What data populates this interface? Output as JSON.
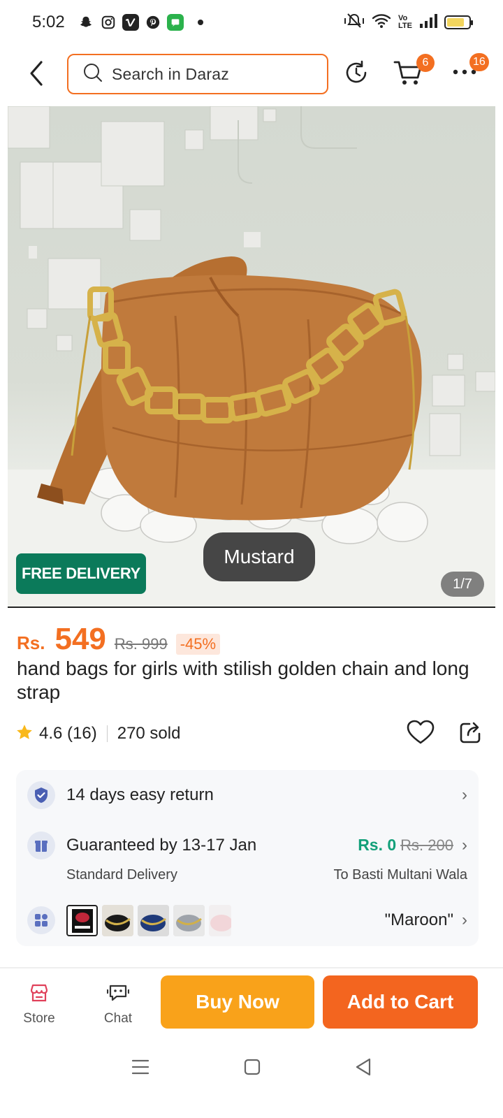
{
  "status_bar": {
    "time": "5:02",
    "app_icons": [
      "snapchat-icon",
      "instagram-icon",
      "vimeo-icon",
      "pinterest-icon",
      "messages-icon"
    ],
    "volte": "Vo LTE"
  },
  "header": {
    "search_placeholder": "Search in Daraz",
    "cart_badge": "6",
    "more_badge": "16"
  },
  "product": {
    "image_badge": "FREE DELIVERY",
    "variant_chip": "Mustard",
    "image_counter": "1/7",
    "currency": "Rs.",
    "price": "549",
    "old_price": "Rs. 999",
    "discount": "-45%",
    "title": "hand bags for girls with stilish golden chain and long strap",
    "rating": "4.6 (16)",
    "sold": "270 sold"
  },
  "info": {
    "return_text": "14 days easy return",
    "delivery_guarantee": "Guaranteed by 13-17 Jan",
    "delivery_type": "Standard Delivery",
    "shipping_price": "Rs. 0",
    "shipping_old_price": "Rs. 200",
    "delivery_location": "To Basti Multani Wala",
    "selected_variant": "\"Maroon\""
  },
  "bottom_bar": {
    "store_label": "Store",
    "chat_label": "Chat",
    "buy_now": "Buy Now",
    "add_to_cart": "Add to Cart"
  },
  "colors": {
    "brand_orange": "#f36f21",
    "buy_now_yellow": "#f9a21a",
    "free_delivery_green": "#0b7a5a",
    "shipping_green": "#13a07a"
  }
}
